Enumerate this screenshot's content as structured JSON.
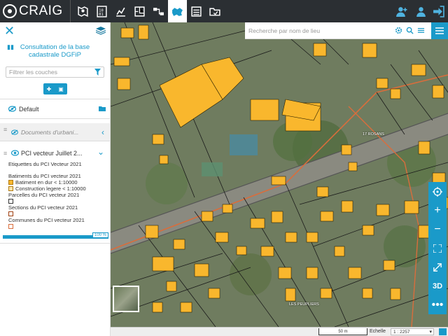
{
  "brand": {
    "name": "CRAIG"
  },
  "toolbar": {
    "tools": [
      "map-pin-icon",
      "binary-icon",
      "chart-icon",
      "blueprint-icon",
      "workflow-icon",
      "regions-icon",
      "list-icon",
      "folder-open-icon"
    ],
    "active_tool": "regions-icon",
    "right_tools": [
      "add-user-icon",
      "users-icon",
      "sign-in-icon"
    ]
  },
  "sidebar": {
    "title": "Consultation de la base cadastrale DGFiP",
    "filter_placeholder": "Filtrer les couches",
    "layers": {
      "default_label": "Default",
      "docs_label": "Documents d'urbani...",
      "pci_label": "PCI vecteur Juillet 2..."
    },
    "legend": {
      "header": "Etiquettes du PCI Vecteur 2021",
      "batiments_title": "Batiments du PCI vecteur 2021",
      "bat_dur": "Batiment en dur < 1:10000",
      "bat_leger": "Construction legere < 1:10000",
      "parcelles": "Parcelles du PCI vecteur 2021",
      "sections": "Sections du PCI vecteur 2021",
      "communes": "Communes du PCI vecteur 2021"
    },
    "progress_label": "100 %",
    "progress": 100
  },
  "map": {
    "search_placeholder": "Recherche par nom de lieu",
    "labels": [
      "17 ROSANS",
      "LES PEUPLIERS"
    ],
    "controls": [
      "locate-icon",
      "zoom-in-icon",
      "zoom-out-icon",
      "expand-icon",
      "fullscreen-icon",
      "3D",
      "more-icon"
    ],
    "colors": {
      "accent": "#1a9ac9",
      "building": "#f9b72d",
      "road": "#d96d3c"
    }
  },
  "status": {
    "scale_text": "50 m",
    "echelle_label": "Echelle",
    "scale_value": "1 : 2257"
  }
}
